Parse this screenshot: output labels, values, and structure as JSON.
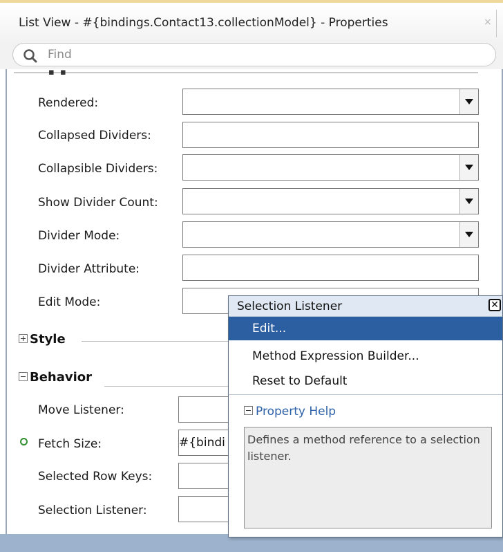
{
  "window": {
    "title": "List View - #{bindings.Contact13.collectionModel} - Properties",
    "close_glyph": "×"
  },
  "search": {
    "placeholder": "Find",
    "icon": "search-icon"
  },
  "properties": [
    {
      "label": "Rendered:",
      "value": "",
      "has_dropdown": true
    },
    {
      "label": "Collapsed Dividers:",
      "value": "",
      "has_dropdown": false
    },
    {
      "label": "Collapsible Dividers:",
      "value": "",
      "has_dropdown": true
    },
    {
      "label": "Show Divider Count:",
      "value": "",
      "has_dropdown": true
    },
    {
      "label": "Divider Mode:",
      "value": "",
      "has_dropdown": true
    },
    {
      "label": "Divider Attribute:",
      "value": "",
      "has_dropdown": false
    },
    {
      "label": "Edit Mode:",
      "value": "",
      "has_dropdown": false
    }
  ],
  "sections": {
    "style": {
      "label": "Style",
      "expanded": false
    },
    "behavior": {
      "label": "Behavior",
      "expanded": true
    }
  },
  "behavior_props": [
    {
      "label": "Move Listener:",
      "value": ""
    },
    {
      "label": "Fetch Size:",
      "value": "#{bindi",
      "modified": true
    },
    {
      "label": "Selected Row Keys:",
      "value": ""
    },
    {
      "label": "Selection Listener:",
      "value": ""
    }
  ],
  "popup": {
    "title": "Selection Listener",
    "close_glyph": "✕",
    "items": [
      {
        "label": "Edit...",
        "selected": true
      },
      {
        "label": "Method Expression Builder...",
        "selected": false
      },
      {
        "label": "Reset to Default",
        "selected": false
      }
    ],
    "help_header": "Property Help",
    "help_text": "Defines a method reference to a selection listener."
  },
  "colors": {
    "selection": "#2c5ea2",
    "help_link": "#2e62a8",
    "modified_dot": "#2f8f2f"
  }
}
